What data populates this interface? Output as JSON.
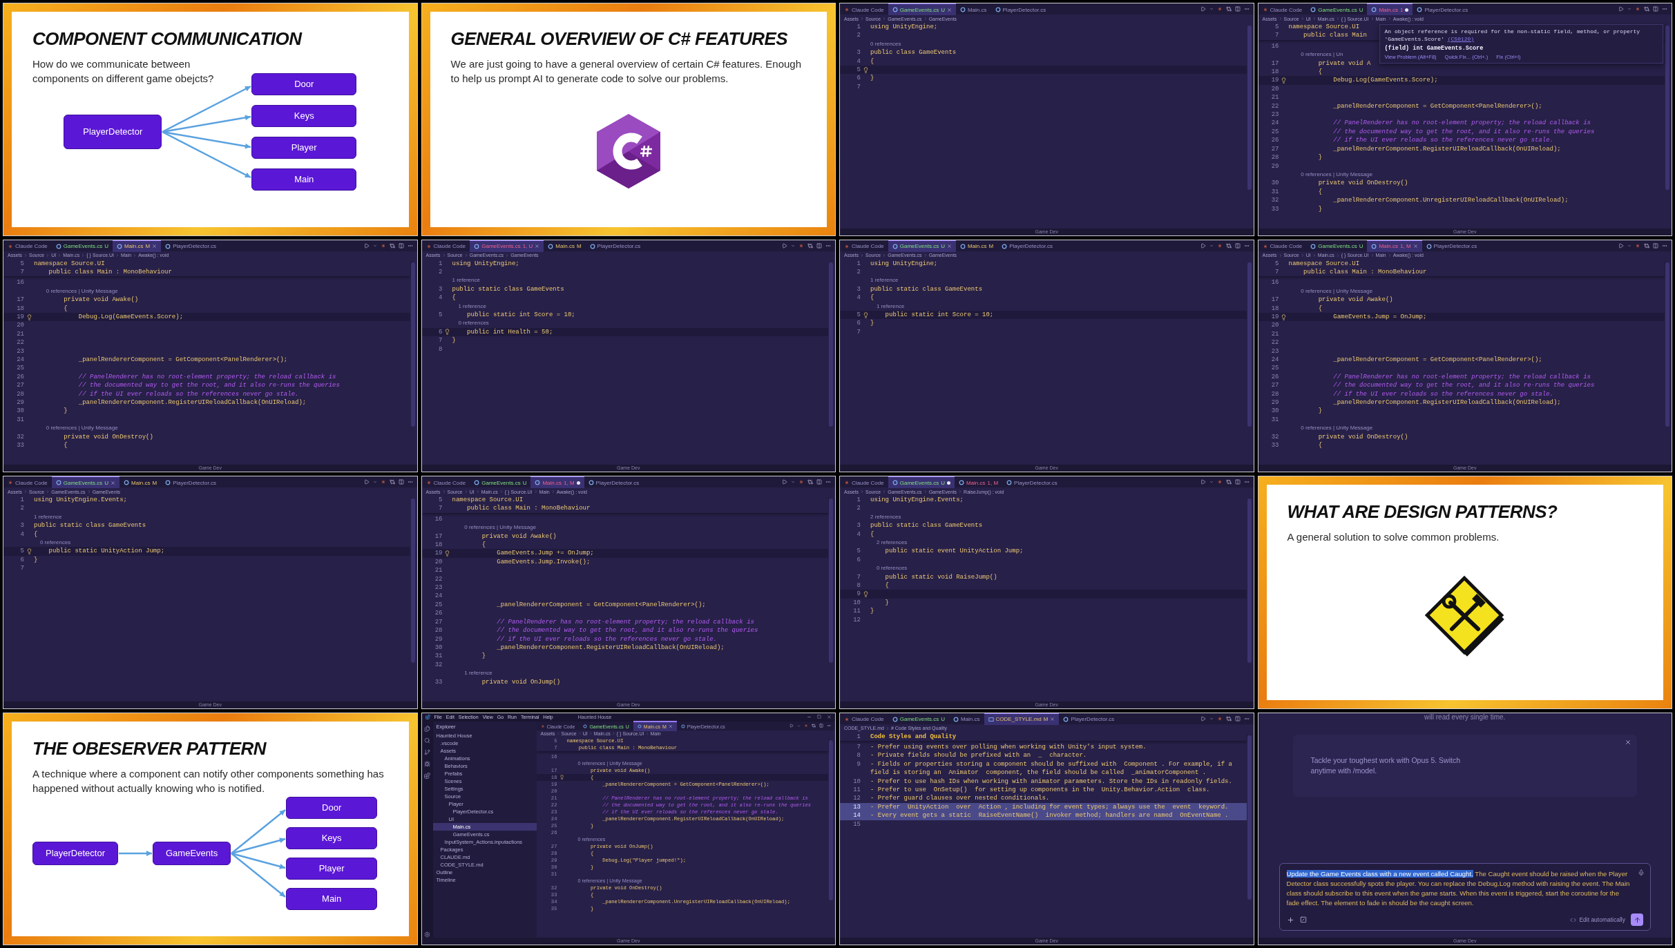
{
  "tiles": [
    {
      "kind": "slide",
      "title": "COMPONENT COMMUNICATION",
      "text": "How do we communicate between components on different game obejcts?",
      "diagram": {
        "source": "PlayerDetector",
        "targets": [
          "Door",
          "Keys",
          "Player",
          "Main"
        ]
      }
    },
    {
      "kind": "slide",
      "title": "GENERAL OVERVIEW OF C# FEATURES",
      "text": "We are just going to have a general overview of certain C# features. Enough to help us prompt AI to generate code to solve our problems.",
      "art": {
        "kind": "hexagon-logo"
      }
    },
    {
      "kind": "editor",
      "footer": "Game Dev",
      "tabs": [
        {
          "kind": "claude",
          "label": "Claude Code",
          "selected": false,
          "modified": false
        },
        {
          "kind": "file-untracked",
          "label": "GameEvents.cs",
          "badge": "U",
          "selected": true,
          "modified": false
        },
        {
          "kind": "file",
          "label": "Main.cs",
          "selected": false,
          "modified": false
        },
        {
          "kind": "file",
          "label": "PlayerDetector.cs",
          "selected": false,
          "modified": false
        }
      ],
      "crumbs": [
        "Assets",
        "Source",
        "GameEvents.cs",
        "GameEvents"
      ],
      "lines": [
        {
          "n": "1",
          "t": "using UnityEngine;",
          "current": false
        },
        {
          "n": "2",
          "current": false
        },
        {
          "kind": "lens",
          "t": "0 references"
        },
        {
          "n": "3",
          "t": "public class GameEvents",
          "current": false
        },
        {
          "n": "4",
          "t": "{",
          "current": false
        },
        {
          "n": "5",
          "current": true
        },
        {
          "n": "6",
          "t": "}",
          "current": false
        },
        {
          "n": "7",
          "current": false
        }
      ]
    },
    {
      "kind": "editor",
      "footer": "Game Dev",
      "tabs": [
        {
          "kind": "claude",
          "label": "Claude Code",
          "selected": false,
          "modified": false
        },
        {
          "kind": "file-untracked",
          "label": "GameEvents.cs",
          "badge": "U",
          "selected": false,
          "modified": false
        },
        {
          "kind": "file-error",
          "label": "Main.cs",
          "badge": "1",
          "selected": true,
          "modified": true
        },
        {
          "kind": "file",
          "label": "PlayerDetector.cs",
          "selected": false,
          "modified": false
        }
      ],
      "crumbs": [
        "Assets",
        "Source",
        "UI",
        "Main.cs",
        "{ } Source.UI",
        "Main",
        "Awake() : void"
      ],
      "sticky": [
        {
          "n": "5",
          "t": "namespace Source.UI",
          "current": false
        },
        {
          "n": "7",
          "t": "    public class Main",
          "current": false
        }
      ],
      "lines": [
        {
          "n": "16",
          "current": false
        },
        {
          "kind": "lens",
          "t": "        0 references | Un"
        },
        {
          "n": "17",
          "t": "        private void A",
          "current": false
        },
        {
          "n": "18",
          "t": "        {",
          "current": false
        },
        {
          "n": "19",
          "t": "            Debug.Log(GameEvents.Score);",
          "current": true
        },
        {
          "n": "20",
          "current": false
        },
        {
          "n": "21",
          "current": false
        },
        {
          "n": "22",
          "t": "            _panelRendererComponent = GetComponent<PanelRenderer>();",
          "current": false
        },
        {
          "n": "23",
          "current": false
        },
        {
          "n": "24",
          "kind": "comment",
          "t": "            // PanelRenderer has no root-element property; the reload callback is",
          "current": false
        },
        {
          "n": "25",
          "kind": "comment",
          "t": "            // the documented way to get the root, and it also re-runs the queries",
          "current": false
        },
        {
          "n": "26",
          "kind": "comment",
          "t": "            // if the UI ever reloads so the references never go stale.",
          "current": false
        },
        {
          "n": "27",
          "t": "            _panelRendererComponent.RegisterUIReloadCallback(OnUIReload);",
          "current": false
        },
        {
          "n": "28",
          "t": "        }",
          "current": false
        },
        {
          "n": "29",
          "current": false
        },
        {
          "kind": "lens",
          "t": "        0 references | Unity Message"
        },
        {
          "n": "30",
          "t": "        private void OnDestroy()",
          "current": false
        },
        {
          "n": "31",
          "t": "        {",
          "current": false
        },
        {
          "n": "32",
          "t": "            _panelRendererComponent.UnregisterUIReloadCallback(OnUIReload);",
          "current": false
        },
        {
          "n": "33",
          "t": "        }",
          "current": false
        }
      ],
      "tooltip": {
        "message": "An object reference is required for the non-static field, method, or property 'GameEvents.Score'",
        "code": "(CS0120)",
        "signature": "(field) int GameEvents.Score",
        "actions": [
          "View Problem (Alt+F8)",
          "Quick Fix... (Ctrl+.)",
          "Fix (Ctrl+I)"
        ]
      }
    },
    {
      "kind": "editor",
      "footer": "Game Dev",
      "tabs": [
        {
          "kind": "claude",
          "label": "Claude Code",
          "selected": false,
          "modified": false
        },
        {
          "kind": "file-untracked",
          "label": "GameEvents.cs",
          "badge": "U",
          "selected": false,
          "modified": false
        },
        {
          "kind": "file-changed",
          "label": "Main.cs",
          "badge": "M",
          "selected": true,
          "modified": false
        },
        {
          "kind": "file",
          "label": "PlayerDetector.cs",
          "selected": false,
          "modified": false
        }
      ],
      "crumbs": [
        "Assets",
        "Source",
        "UI",
        "Main.cs",
        "{ } Source.UI",
        "Main",
        "Awake() : void"
      ],
      "sticky": [
        {
          "n": "5",
          "t": "namespace Source.UI",
          "current": false
        },
        {
          "n": "7",
          "t": "    public class Main : MonoBehaviour",
          "current": false
        }
      ],
      "lines": [
        {
          "n": "16",
          "current": false
        },
        {
          "kind": "lens",
          "t": "        0 references | Unity Message"
        },
        {
          "n": "17",
          "t": "        private void Awake()",
          "current": false
        },
        {
          "n": "18",
          "t": "        {",
          "current": false
        },
        {
          "n": "19",
          "t": "            Debug.Log(GameEvents.Score);",
          "current": true
        },
        {
          "n": "20",
          "current": false
        },
        {
          "n": "21",
          "current": false
        },
        {
          "n": "22",
          "current": false
        },
        {
          "n": "23",
          "current": false
        },
        {
          "n": "24",
          "t": "            _panelRendererComponent = GetComponent<PanelRenderer>();",
          "current": false
        },
        {
          "n": "25",
          "current": false
        },
        {
          "n": "26",
          "kind": "comment",
          "t": "            // PanelRenderer has no root-element property; the reload callback is",
          "current": false
        },
        {
          "n": "27",
          "kind": "comment",
          "t": "            // the documented way to get the root, and it also re-runs the queries",
          "current": false
        },
        {
          "n": "28",
          "kind": "comment",
          "t": "            // if the UI ever reloads so the references never go stale.",
          "current": false
        },
        {
          "n": "29",
          "t": "            _panelRendererComponent.RegisterUIReloadCallback(OnUIReload);",
          "current": false
        },
        {
          "n": "30",
          "t": "        }",
          "current": false
        },
        {
          "n": "31",
          "current": false
        },
        {
          "kind": "lens",
          "t": "        0 references | Unity Message"
        },
        {
          "n": "32",
          "t": "        private void OnDestroy()",
          "current": false
        },
        {
          "n": "33",
          "t": "        {",
          "current": false
        }
      ]
    },
    {
      "kind": "editor",
      "footer": "Game Dev",
      "tabs": [
        {
          "kind": "claude",
          "label": "Claude Code",
          "selected": false,
          "modified": false
        },
        {
          "kind": "file-error",
          "label": "GameEvents.cs",
          "badge": "1, U",
          "selected": true,
          "modified": false
        },
        {
          "kind": "file-changed",
          "label": "Main.cs",
          "badge": "M",
          "selected": false,
          "modified": false
        },
        {
          "kind": "file",
          "label": "PlayerDetector.cs",
          "selected": false,
          "modified": false
        }
      ],
      "crumbs": [
        "Assets",
        "Source",
        "GameEvents.cs",
        "GameEvents"
      ],
      "lines": [
        {
          "n": "1",
          "t": "using UnityEngine;",
          "current": false
        },
        {
          "n": "2",
          "current": false
        },
        {
          "kind": "lens",
          "t": "1 reference"
        },
        {
          "n": "3",
          "t": "public static class GameEvents",
          "current": false
        },
        {
          "n": "4",
          "t": "{",
          "current": false
        },
        {
          "kind": "lens",
          "t": "    1 reference"
        },
        {
          "n": "5",
          "t": "    public static int Score = 10;",
          "current": false
        },
        {
          "kind": "lens",
          "t": "    0 references"
        },
        {
          "n": "6",
          "t": "    public int Health = 50;",
          "current": true
        },
        {
          "n": "7",
          "t": "}",
          "current": false
        },
        {
          "n": "8",
          "current": false
        }
      ]
    },
    {
      "kind": "editor",
      "footer": "Game Dev",
      "tabs": [
        {
          "kind": "claude",
          "label": "Claude Code",
          "selected": false,
          "modified": false
        },
        {
          "kind": "file-untracked",
          "label": "GameEvents.cs",
          "badge": "U",
          "selected": true,
          "modified": false
        },
        {
          "kind": "file-changed",
          "label": "Main.cs",
          "badge": "M",
          "selected": false,
          "modified": false
        },
        {
          "kind": "file",
          "label": "PlayerDetector.cs",
          "selected": false,
          "modified": false
        }
      ],
      "crumbs": [
        "Assets",
        "Source",
        "GameEvents.cs",
        "GameEvents"
      ],
      "lines": [
        {
          "n": "1",
          "t": "using UnityEngine;",
          "current": false
        },
        {
          "n": "2",
          "current": false
        },
        {
          "kind": "lens",
          "t": "1 reference"
        },
        {
          "n": "3",
          "t": "public static class GameEvents",
          "current": false
        },
        {
          "n": "4",
          "t": "{",
          "current": false
        },
        {
          "kind": "lens",
          "t": "    1 reference"
        },
        {
          "n": "5",
          "t": "    public static int Score = 10;",
          "current": true
        },
        {
          "n": "6",
          "t": "}",
          "current": false
        },
        {
          "n": "7",
          "current": false
        }
      ]
    },
    {
      "kind": "editor",
      "footer": "Game Dev",
      "tabs": [
        {
          "kind": "claude",
          "label": "Claude Code",
          "selected": false,
          "modified": false
        },
        {
          "kind": "file-untracked",
          "label": "GameEvents.cs",
          "badge": "U",
          "selected": false,
          "modified": false
        },
        {
          "kind": "file-error",
          "label": "Main.cs",
          "badge": "1, M",
          "selected": true,
          "modified": false
        },
        {
          "kind": "file",
          "label": "PlayerDetector.cs",
          "selected": false,
          "modified": false
        }
      ],
      "crumbs": [
        "Assets",
        "Source",
        "UI",
        "Main.cs",
        "{ } Source.UI",
        "Main",
        "Awake() : void"
      ],
      "sticky": [
        {
          "n": "5",
          "t": "namespace Source.UI",
          "current": false
        },
        {
          "n": "7",
          "t": "    public class Main : MonoBehaviour",
          "current": false
        }
      ],
      "lines": [
        {
          "n": "16",
          "current": false
        },
        {
          "kind": "lens",
          "t": "        0 references | Unity Message"
        },
        {
          "n": "17",
          "t": "        private void Awake()",
          "current": false
        },
        {
          "n": "18",
          "t": "        {",
          "current": false
        },
        {
          "n": "19",
          "t": "            GameEvents.Jump = OnJump;",
          "current": true
        },
        {
          "n": "20",
          "current": false
        },
        {
          "n": "21",
          "current": false
        },
        {
          "n": "22",
          "current": false
        },
        {
          "n": "23",
          "current": false
        },
        {
          "n": "24",
          "t": "            _panelRendererComponent = GetComponent<PanelRenderer>();",
          "current": false
        },
        {
          "n": "25",
          "current": false
        },
        {
          "n": "26",
          "kind": "comment",
          "t": "            // PanelRenderer has no root-element property; the reload callback is",
          "current": false
        },
        {
          "n": "27",
          "kind": "comment",
          "t": "            // the documented way to get the root, and it also re-runs the queries",
          "current": false
        },
        {
          "n": "28",
          "kind": "comment",
          "t": "            // if the UI ever reloads so the references never go stale.",
          "current": false
        },
        {
          "n": "29",
          "t": "            _panelRendererComponent.RegisterUIReloadCallback(OnUIReload);",
          "current": false
        },
        {
          "n": "30",
          "t": "        }",
          "current": false
        },
        {
          "n": "31",
          "current": false
        },
        {
          "kind": "lens",
          "t": "        0 references | Unity Message"
        },
        {
          "n": "32",
          "t": "        private void OnDestroy()",
          "current": false
        },
        {
          "n": "33",
          "t": "        {",
          "current": false
        }
      ]
    },
    {
      "kind": "editor",
      "footer": "Game Dev",
      "tabs": [
        {
          "kind": "claude",
          "label": "Claude Code",
          "selected": false,
          "modified": false
        },
        {
          "kind": "file-untracked",
          "label": "GameEvents.cs",
          "badge": "U",
          "selected": true,
          "modified": false
        },
        {
          "kind": "file-changed",
          "label": "Main.cs",
          "badge": "M",
          "selected": false,
          "modified": false
        },
        {
          "kind": "file",
          "label": "PlayerDetector.cs",
          "selected": false,
          "modified": false
        }
      ],
      "crumbs": [
        "Assets",
        "Source",
        "GameEvents.cs",
        "GameEvents"
      ],
      "lines": [
        {
          "n": "1",
          "t": "using UnityEngine.Events;",
          "current": false
        },
        {
          "n": "2",
          "current": false
        },
        {
          "kind": "lens",
          "t": "1 reference"
        },
        {
          "n": "3",
          "t": "public static class GameEvents",
          "current": false
        },
        {
          "n": "4",
          "t": "{",
          "current": false
        },
        {
          "kind": "lens",
          "t": "    0 references"
        },
        {
          "n": "5",
          "t": "    public static UnityAction Jump;",
          "current": true
        },
        {
          "n": "6",
          "t": "}",
          "current": false
        },
        {
          "n": "7",
          "current": false
        }
      ]
    },
    {
      "kind": "editor",
      "footer": "Game Dev",
      "tabs": [
        {
          "kind": "claude",
          "label": "Claude Code",
          "selected": false,
          "modified": false
        },
        {
          "kind": "file-untracked",
          "label": "GameEvents.cs",
          "badge": "U",
          "selected": false,
          "modified": false
        },
        {
          "kind": "file-error",
          "label": "Main.cs",
          "badge": "1, M",
          "selected": true,
          "modified": true
        },
        {
          "kind": "file",
          "label": "PlayerDetector.cs",
          "selected": false,
          "modified": false
        }
      ],
      "crumbs": [
        "Assets",
        "Source",
        "UI",
        "Main.cs",
        "{ } Source.UI",
        "Main",
        "Awake() : void"
      ],
      "sticky": [
        {
          "n": "5",
          "t": "namespace Source.UI",
          "current": false
        },
        {
          "n": "7",
          "t": "    public class Main : MonoBehaviour",
          "current": false
        }
      ],
      "lines": [
        {
          "n": "16",
          "current": false
        },
        {
          "kind": "lens",
          "t": "        0 references | Unity Message"
        },
        {
          "n": "17",
          "t": "        private void Awake()",
          "current": false
        },
        {
          "n": "18",
          "t": "        {",
          "current": false
        },
        {
          "n": "19",
          "t": "            GameEvents.Jump += OnJump;",
          "current": true
        },
        {
          "n": "20",
          "t": "            GameEvents.Jump.Invoke();",
          "current": false
        },
        {
          "n": "21",
          "current": false
        },
        {
          "n": "22",
          "current": false
        },
        {
          "n": "23",
          "current": false
        },
        {
          "n": "24",
          "current": false
        },
        {
          "n": "25",
          "t": "            _panelRendererComponent = GetComponent<PanelRenderer>();",
          "current": false
        },
        {
          "n": "26",
          "current": false
        },
        {
          "n": "27",
          "kind": "comment",
          "t": "            // PanelRenderer has no root-element property; the reload callback is",
          "current": false
        },
        {
          "n": "28",
          "kind": "comment",
          "t": "            // the documented way to get the root, and it also re-runs the queries",
          "current": false
        },
        {
          "n": "29",
          "kind": "comment",
          "t": "            // if the UI ever reloads so the references never go stale.",
          "current": false
        },
        {
          "n": "30",
          "t": "            _panelRendererComponent.RegisterUIReloadCallback(OnUIReload);",
          "current": false
        },
        {
          "n": "31",
          "t": "        }",
          "current": false
        },
        {
          "n": "32",
          "current": false
        },
        {
          "kind": "lens",
          "t": "        1 reference"
        },
        {
          "n": "33",
          "t": "        private void OnJump()",
          "current": false
        }
      ]
    },
    {
      "kind": "editor",
      "footer": "Game Dev",
      "tabs": [
        {
          "kind": "claude",
          "label": "Claude Code",
          "selected": false,
          "modified": false
        },
        {
          "kind": "file-untracked",
          "label": "GameEvents.cs",
          "badge": "U",
          "selected": true,
          "modified": true
        },
        {
          "kind": "file-error",
          "label": "Main.cs",
          "badge": "1, M",
          "selected": false,
          "modified": false
        },
        {
          "kind": "file",
          "label": "PlayerDetector.cs",
          "selected": false,
          "modified": false
        }
      ],
      "crumbs": [
        "Assets",
        "Source",
        "GameEvents.cs",
        "GameEvents",
        "RaiseJump() : void"
      ],
      "lines": [
        {
          "n": "1",
          "t": "using UnityEngine.Events;",
          "current": false
        },
        {
          "n": "2",
          "current": false
        },
        {
          "kind": "lens",
          "t": "2 references"
        },
        {
          "n": "3",
          "t": "public static class GameEvents",
          "current": false
        },
        {
          "n": "4",
          "t": "{",
          "current": false
        },
        {
          "kind": "lens",
          "t": "    2 references"
        },
        {
          "n": "5",
          "t": "    public static event UnityAction Jump;",
          "current": false
        },
        {
          "n": "6",
          "current": false
        },
        {
          "kind": "lens",
          "t": "    0 references"
        },
        {
          "n": "7",
          "t": "    public static void RaiseJump()",
          "current": false
        },
        {
          "n": "8",
          "t": "    {",
          "current": false
        },
        {
          "n": "9",
          "current": true
        },
        {
          "n": "10",
          "t": "    }",
          "current": false
        },
        {
          "n": "11",
          "t": "}",
          "current": false
        },
        {
          "n": "12",
          "current": false
        }
      ]
    },
    {
      "kind": "slide",
      "title": "WHAT ARE DESIGN PATTERNS?",
      "text": "A general solution to solve common problems.",
      "art": {
        "kind": "tools-sign"
      }
    },
    {
      "kind": "slide",
      "title": "THE OBESERVER PATTERN",
      "text": "A technique where a component can notify other components something has happened without actually knowing who is notified.",
      "diagram": {
        "source": "PlayerDetector",
        "hub": "GameEvents",
        "targets": [
          "Door",
          "Keys",
          "Player",
          "Main"
        ]
      }
    },
    {
      "kind": "ide",
      "footer": "Game Dev",
      "menu": [
        "File",
        "Edit",
        "Selection",
        "View",
        "Go",
        "Run",
        "Terminal",
        "Help"
      ],
      "title": "Haunted House",
      "explorer_title": "Explorer",
      "tree": [
        {
          "label": "Haunted House",
          "selected": false,
          "children": [
            {
              "label": ".vscode",
              "selected": false
            },
            {
              "label": "Assets",
              "selected": false,
              "children": [
                {
                  "label": "Animations",
                  "selected": false
                },
                {
                  "label": "Behaviors",
                  "selected": false
                },
                {
                  "label": "Prefabs",
                  "selected": false
                },
                {
                  "label": "Scenes",
                  "selected": false
                },
                {
                  "label": "Settings",
                  "selected": false
                },
                {
                  "label": "Source",
                  "selected": false,
                  "children": [
                    {
                      "label": "Player",
                      "selected": false,
                      "children": [
                        {
                          "label": "PlayerDetector.cs",
                          "selected": false
                        }
                      ]
                    },
                    {
                      "label": "UI",
                      "selected": false,
                      "children": [
                        {
                          "label": "Main.cs",
                          "selected": true
                        },
                        {
                          "label": "GameEvents.cs",
                          "selected": false
                        }
                      ]
                    }
                  ]
                },
                {
                  "label": "InputSystem_Actions.inputactions",
                  "selected": false
                }
              ]
            },
            {
              "label": "Packages",
              "selected": false
            },
            {
              "label": "CLAUDE.md",
              "selected": false
            },
            {
              "label": "CODE_STYLE.md",
              "selected": false
            }
          ]
        },
        {
          "label": "Outline",
          "selected": false
        },
        {
          "label": "Timeline",
          "selected": false
        }
      ],
      "editor": {
        "tabs": [
          {
            "kind": "claude",
            "label": "Claude Code",
            "selected": false,
            "modified": false
          },
          {
            "kind": "file-untracked",
            "label": "GameEvents.cs",
            "badge": "U",
            "selected": false,
            "modified": false
          },
          {
            "kind": "file-changed",
            "label": "Main.cs",
            "badge": "M",
            "selected": true,
            "modified": false
          },
          {
            "kind": "file",
            "label": "PlayerDetector.cs",
            "selected": false,
            "modified": false
          }
        ],
        "crumbs": [
          "Assets",
          "Source",
          "UI",
          "Main.cs",
          "{ } Source.UI",
          "Main"
        ],
        "sticky": [
          {
            "n": "5",
            "t": "namespace Source.UI",
            "current": false
          },
          {
            "n": "7",
            "t": "    public class Main : MonoBehaviour",
            "current": false
          }
        ],
        "lines": [
          {
            "n": "16",
            "current": false
          },
          {
            "kind": "lens",
            "t": "        0 references | Unity Message"
          },
          {
            "n": "17",
            "t": "        private void Awake()",
            "current": false
          },
          {
            "n": "18",
            "t": "        {",
            "current": true
          },
          {
            "n": "19",
            "t": "            _panelRendererComponent = GetComponent<PanelRenderer>();",
            "current": false
          },
          {
            "n": "20",
            "current": false
          },
          {
            "n": "21",
            "kind": "comment",
            "t": "            // PanelRenderer has no root-element property; the reload callback is",
            "current": false
          },
          {
            "n": "22",
            "kind": "comment",
            "t": "            // the documented way to get the root, and it also re-runs the queries",
            "current": false
          },
          {
            "n": "23",
            "kind": "comment",
            "t": "            // if the UI ever reloads so the references never go stale.",
            "current": false
          },
          {
            "n": "24",
            "t": "            _panelRendererComponent.RegisterUIReloadCallback(OnUIReload);",
            "current": false
          },
          {
            "n": "25",
            "t": "        }",
            "current": false
          },
          {
            "n": "26",
            "current": false
          },
          {
            "kind": "lens",
            "t": "        0 references"
          },
          {
            "n": "27",
            "t": "        private void OnJump()",
            "current": false
          },
          {
            "n": "28",
            "t": "        {",
            "current": false
          },
          {
            "n": "29",
            "t": "            Debug.Log(\"Player jumped!\");",
            "current": false
          },
          {
            "n": "30",
            "t": "        }",
            "current": false
          },
          {
            "n": "31",
            "current": false
          },
          {
            "kind": "lens",
            "t": "        0 references | Unity Message"
          },
          {
            "n": "32",
            "t": "        private void OnDestroy()",
            "current": false
          },
          {
            "n": "33",
            "t": "        {",
            "current": false
          },
          {
            "n": "34",
            "t": "            _panelRendererComponent.UnregisterUIReloadCallback(OnUIReload);",
            "current": false
          },
          {
            "n": "35",
            "t": "        }",
            "current": false
          }
        ]
      }
    },
    {
      "kind": "editor",
      "footer": "Game Dev",
      "wrap": true,
      "tabs": [
        {
          "kind": "claude",
          "label": "Claude Code",
          "selected": false,
          "modified": false
        },
        {
          "kind": "file-untracked",
          "label": "GameEvents.cs",
          "badge": "U",
          "selected": false,
          "modified": false
        },
        {
          "kind": "file",
          "label": "Main.cs",
          "selected": false,
          "modified": false
        },
        {
          "kind": "md-changed",
          "label": "CODE_STYLE.md",
          "badge": "M",
          "selected": true,
          "modified": false
        },
        {
          "kind": "file",
          "label": "PlayerDetector.cs",
          "selected": false,
          "modified": false
        }
      ],
      "crumbs": [
        "CODE_STYLE.md",
        "# Code Styles and Quality"
      ],
      "sticky": [
        {
          "n": "1",
          "kind": "heading",
          "t": "Code Styles and Quality",
          "current": false,
          "selected": false
        }
      ],
      "lines": [
        {
          "n": "7",
          "t": "- Prefer using events over polling when working with Unity's input system.",
          "current": false,
          "selected": false
        },
        {
          "n": "8",
          "t": "- Private fields should be prefixed with an  _  character.",
          "current": false,
          "selected": false
        },
        {
          "n": "9",
          "t": "- Fields or properties storing a component should be suffixed with  Component . For example, if a field is storing an  Animator  component, the field should be called  _animatorComponent .",
          "current": false,
          "selected": false
        },
        {
          "n": "10",
          "t": "- Prefer to use hash IDs when working with animator parameters. Store the IDs in readonly fields.",
          "current": false,
          "selected": false
        },
        {
          "n": "11",
          "t": "- Prefer to use  OnSetup()  for setting up components in the  Unity.Behavior.Action  class.",
          "current": false,
          "selected": false
        },
        {
          "n": "12",
          "t": "- Prefer guard clauses over nested conditionals.",
          "current": false,
          "selected": false
        },
        {
          "n": "13",
          "t": "- Prefer  UnityAction  over  Action , including for event types; always use the  event  keyword.",
          "current": false,
          "selected": true
        },
        {
          "n": "14",
          "t": "- Every event gets a static  RaiseEventName()  invoker method; handlers are named  OnEventName .",
          "current": false,
          "selected": true
        },
        {
          "n": "15",
          "current": false,
          "selected": false
        }
      ]
    },
    {
      "kind": "chat",
      "footer": "Game Dev",
      "top_text": "will read every single time.",
      "tip": "Tackle your toughest work with Opus 5. Switch anytime with /model.",
      "prompt": [
        {
          "text": "Update the Game Events class with a new event called Caught.",
          "selected": true
        },
        {
          "text": " The Caught event should be raised when the Player Detector class successfully spots the player. You can replace the Debug.Log method with raising the event. The Main class should subscribe to this event when the game starts. When this event is triggered, start the coroutine for the fade effect. The element to fade in should be the caught screen.",
          "selected": false
        }
      ],
      "mode": "Edit automatically"
    }
  ]
}
